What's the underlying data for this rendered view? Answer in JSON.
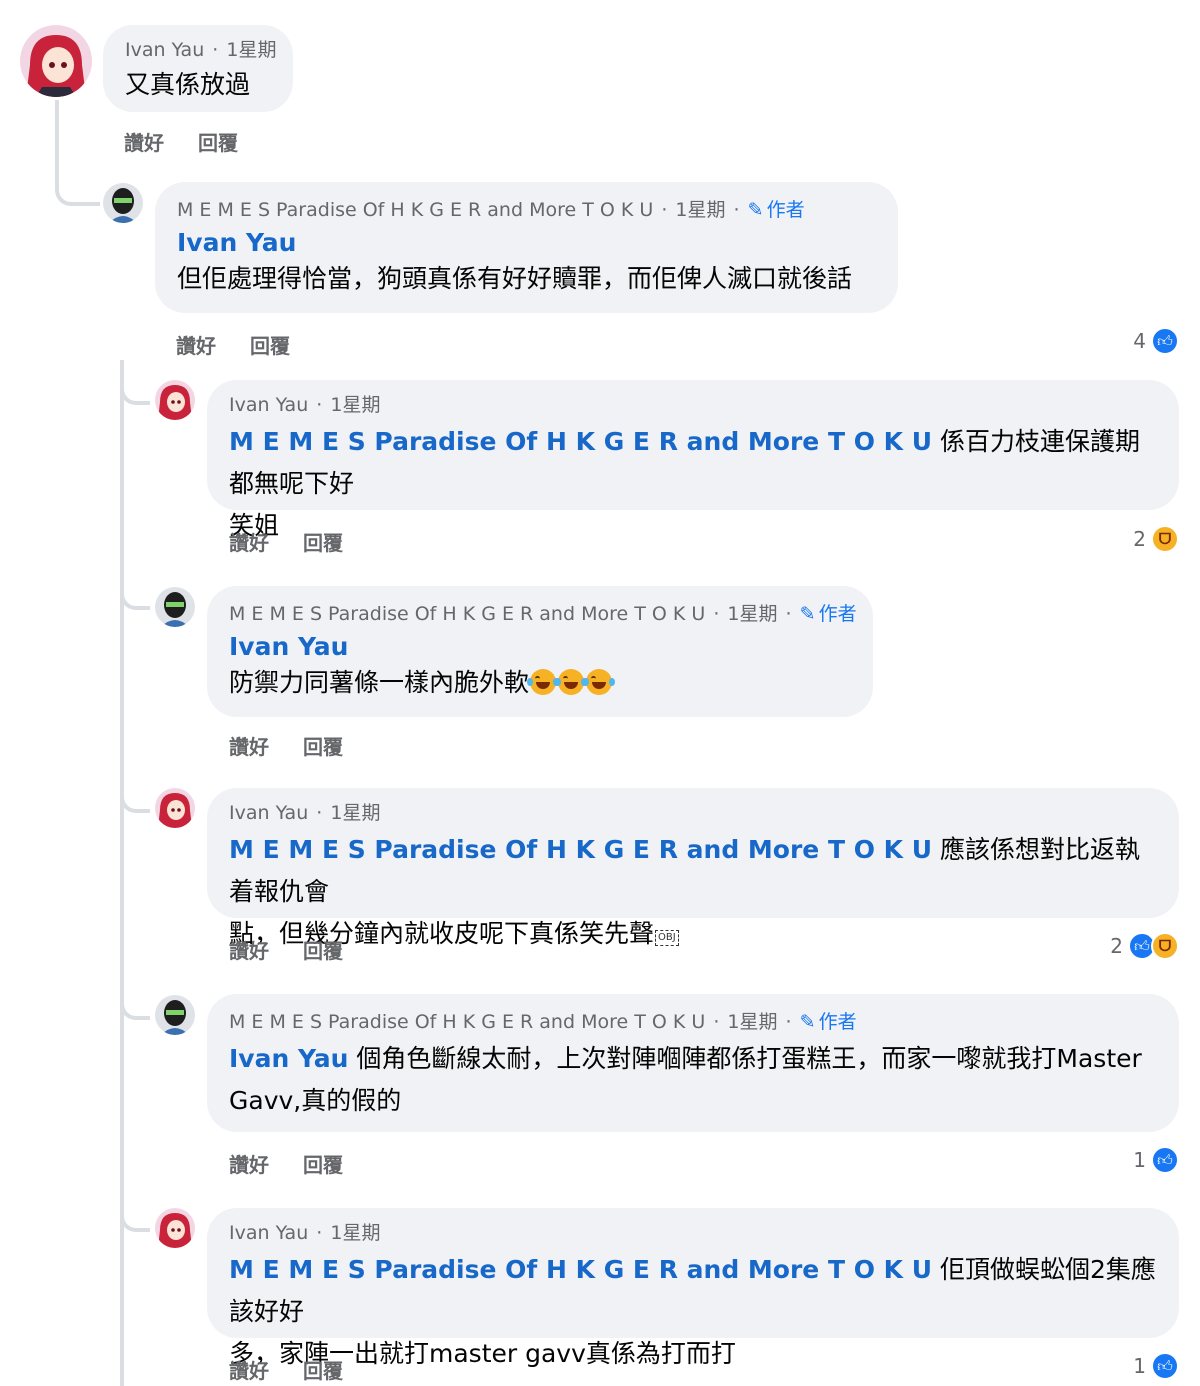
{
  "comments": [
    {
      "id": "c1",
      "author": "Ivan Yau",
      "time": "1星期",
      "text": "又真係放過",
      "actions": {
        "like": "讚好",
        "reply": "回覆"
      }
    },
    {
      "id": "c2",
      "author": "M E M E S Paradise Of H K G E R and More T O K U",
      "time": "1星期",
      "badge": "作者",
      "mention": "Ivan Yau",
      "text": "但佢處理得恰當，狗頭真係有好好贖罪，而佢俾人滅口就後話",
      "actions": {
        "like": "讚好",
        "reply": "回覆"
      },
      "reaction_count": "4",
      "reactions": [
        "like"
      ]
    },
    {
      "id": "c3",
      "author": "Ivan Yau",
      "time": "1星期",
      "mention": "M E M E S Paradise Of H K G E R and More T O K U",
      "text_line1": "係百力枝連保護期都無呢下好",
      "text_line2": "笑姐",
      "actions": {
        "like": "讚好",
        "reply": "回覆"
      },
      "reaction_count": "2",
      "reactions": [
        "haha"
      ]
    },
    {
      "id": "c4",
      "author": "M E M E S Paradise Of H K G E R and More T O K U",
      "time": "1星期",
      "badge": "作者",
      "mention": "Ivan Yau",
      "text": "防禦力同薯條一樣內脆外軟",
      "emojis": [
        "face-with-tears-of-joy",
        "face-with-tears-of-joy",
        "face-with-tears-of-joy"
      ],
      "actions": {
        "like": "讚好",
        "reply": "回覆"
      }
    },
    {
      "id": "c5",
      "author": "Ivan Yau",
      "time": "1星期",
      "mention": "M E M E S Paradise Of H K G E R and More T O K U",
      "text_line1": "應該係想對比返執着報仇會",
      "text_line2": "點，但幾分鐘內就收皮呢下真係笑先聲",
      "obj_marker": "OBJ",
      "actions": {
        "like": "讚好",
        "reply": "回覆"
      },
      "reaction_count": "2",
      "reactions": [
        "like",
        "haha"
      ]
    },
    {
      "id": "c6",
      "author": "M E M E S Paradise Of H K G E R and More T O K U",
      "time": "1星期",
      "badge": "作者",
      "mention": "Ivan Yau",
      "text_line1": "個角色斷線太耐，上次對陣嗰陣都係打蛋糕王，而家一嚟就我打Master",
      "text_line2": "Gavv,真的假的",
      "actions": {
        "like": "讚好",
        "reply": "回覆"
      },
      "reaction_count": "1",
      "reactions": [
        "like"
      ]
    },
    {
      "id": "c7",
      "author": "Ivan Yau",
      "time": "1星期",
      "mention": "M E M E S Paradise Of H K G E R and More T O K U",
      "text_line1": "佢頂做蜈蚣個2集應該好好",
      "text_line2": "多，家陣一出就打master gavv真係為打而打",
      "actions": {
        "like": "讚好",
        "reply": "回覆"
      },
      "reaction_count": "1",
      "reactions": [
        "like"
      ]
    }
  ],
  "separator": "·",
  "colors": {
    "bubble": "#f0f2f5",
    "link": "#1768c8",
    "meta": "#65676b",
    "like_blue": "#1877f2",
    "haha_yellow": "#f7b125"
  }
}
